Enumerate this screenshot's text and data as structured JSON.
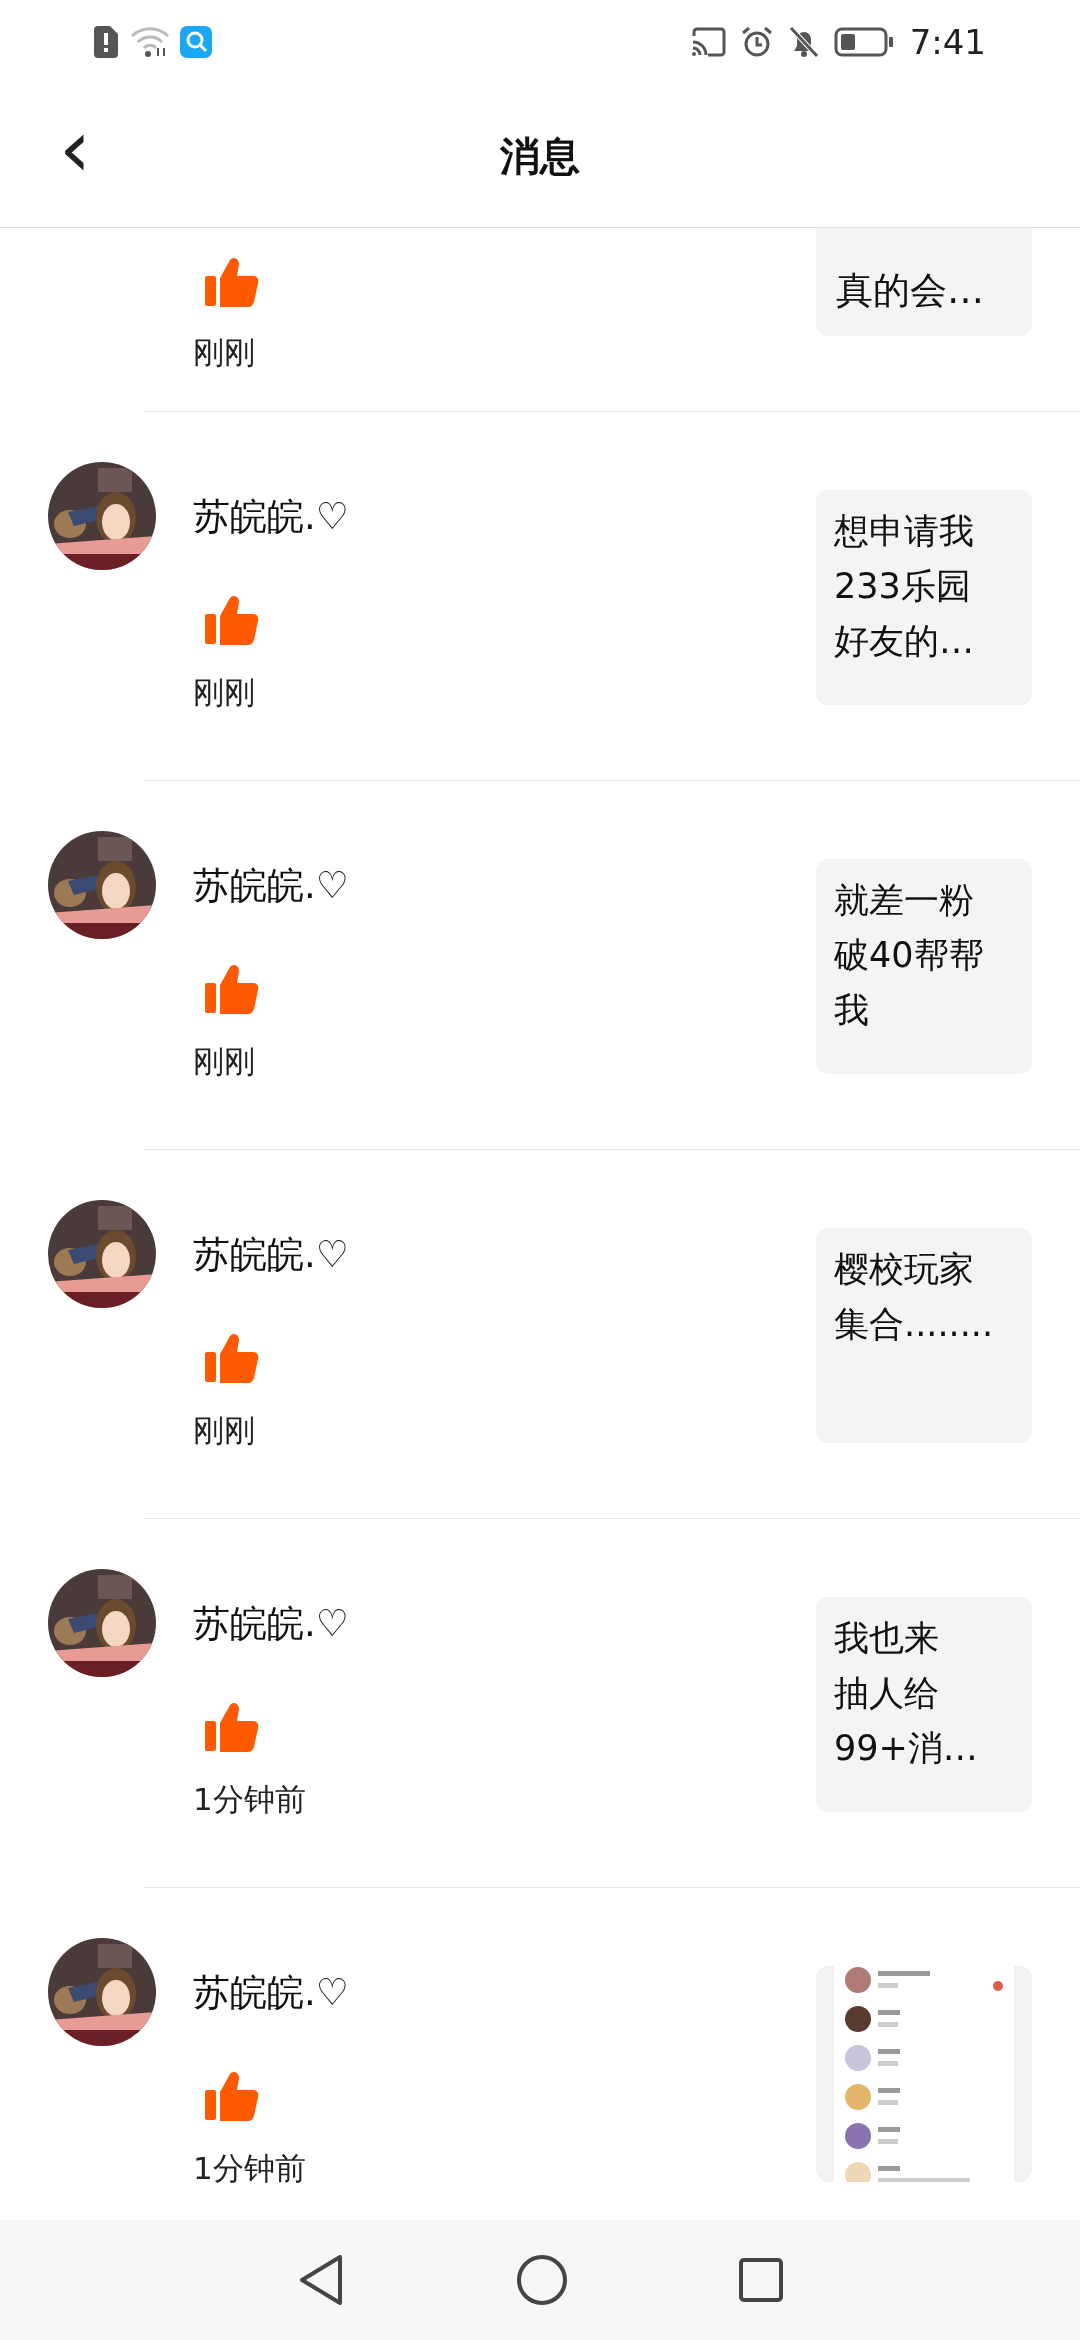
{
  "status_bar": {
    "time": "7:41"
  },
  "header": {
    "back": "‹",
    "title": "消息"
  },
  "messages": [
    {
      "kind": "partial",
      "liked": true,
      "time": "刚刚",
      "snippet": [
        "真的会…"
      ]
    },
    {
      "kind": "full",
      "name": "苏皖皖.♡",
      "liked": true,
      "time": "刚刚",
      "snippet": [
        "想申请我",
        "233乐园",
        "好友的…"
      ]
    },
    {
      "kind": "full",
      "name": "苏皖皖.♡",
      "liked": true,
      "time": "刚刚",
      "snippet": [
        "就差一粉",
        "破40帮帮",
        "我"
      ]
    },
    {
      "kind": "full",
      "name": "苏皖皖.♡",
      "liked": true,
      "time": "刚刚",
      "snippet": [
        "樱校玩家",
        "集合........"
      ]
    },
    {
      "kind": "full",
      "name": "苏皖皖.♡",
      "liked": true,
      "time": "1分钟前",
      "snippet": [
        "我也来",
        "抽人给",
        "99+消…"
      ]
    },
    {
      "kind": "full",
      "name": "苏皖皖.♡",
      "liked": true,
      "time": "1分钟前"
    }
  ]
}
